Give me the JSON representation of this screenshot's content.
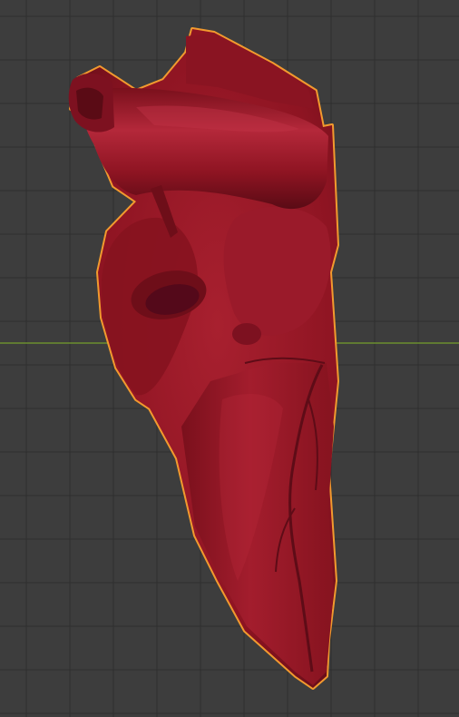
{
  "viewport": {
    "background": "#3d3d3d",
    "grid_color": "#2f2f2f",
    "x_axis_color": "#6b8e2e",
    "selection_outline_color": "#f29a2e"
  },
  "object": {
    "name": "heart-mesh",
    "selected": true,
    "base_color": "#8e1422",
    "shadow_color": "#5a0b15",
    "highlight_color": "#b8283a"
  }
}
